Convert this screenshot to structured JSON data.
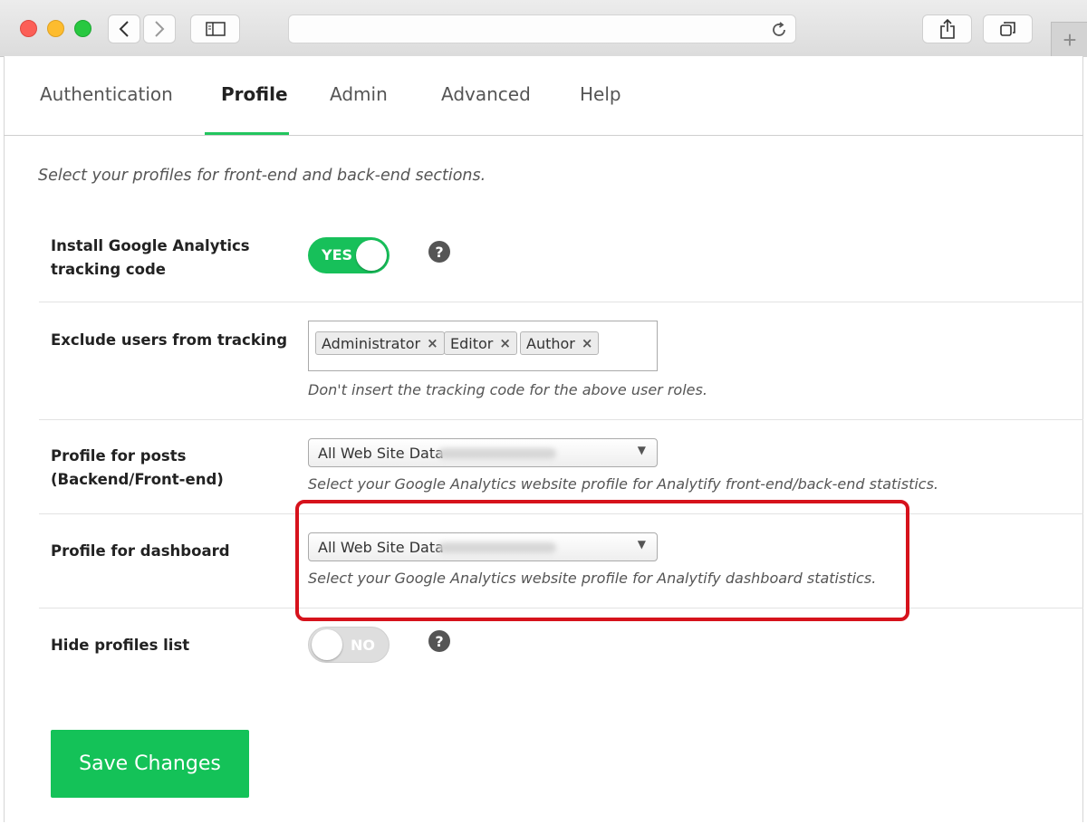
{
  "tabs": [
    {
      "label": "Authentication"
    },
    {
      "label": "Profile"
    },
    {
      "label": "Admin"
    },
    {
      "label": "Advanced"
    },
    {
      "label": "Help"
    }
  ],
  "active_tab": "Profile",
  "intro": "Select your profiles for front-end and back-end sections.",
  "rows": {
    "install": {
      "label": "Install Google Analytics tracking code",
      "toggle": "YES",
      "enabled": true
    },
    "exclude": {
      "label": "Exclude users from tracking",
      "chips": [
        "Administrator",
        "Editor",
        "Author"
      ],
      "hint": "Don't insert the tracking code for the above user roles."
    },
    "posts": {
      "label": "Profile for posts (Backend/Front-end)",
      "select_value": "All Web Site Data",
      "hint": "Select your Google Analytics website profile for Analytify front-end/back-end statistics."
    },
    "dashboard": {
      "label": "Profile for dashboard",
      "select_value": "All Web Site Data",
      "hint": "Select your Google Analytics website profile for Analytify dashboard statistics."
    },
    "hide": {
      "label": "Hide profiles list",
      "toggle": "NO",
      "enabled": false
    }
  },
  "help_glyph": "?",
  "chip_remove": "×",
  "select_caret": "▼",
  "save_label": "Save Changes",
  "colors": {
    "accent": "#17c05a",
    "highlight": "#d6121c"
  }
}
